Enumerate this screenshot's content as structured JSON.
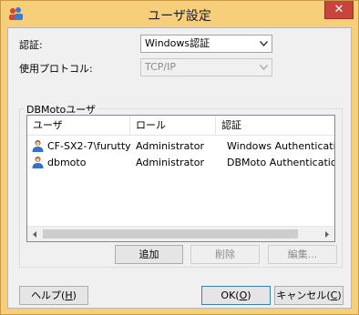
{
  "window": {
    "title": "ユーザ設定",
    "close_label": "✕"
  },
  "form": {
    "auth_label": "認証:",
    "auth_value": "Windows認証",
    "protocol_label": "使用プロトコル:",
    "protocol_value": "TCP/IP"
  },
  "group": {
    "label": "DBMotoユーザ",
    "columns": [
      "ユーザ",
      "ロール",
      "認証"
    ],
    "rows": [
      {
        "user": "CF-SX2-7\\furutty",
        "role": "Administrator",
        "auth": "Windows Authentication"
      },
      {
        "user": "dbmoto",
        "role": "Administrator",
        "auth": "DBMoto Authentication"
      }
    ],
    "buttons": {
      "add": "追加",
      "delete": "削除",
      "edit": "編集..."
    }
  },
  "footer": {
    "help_prefix": "ヘルプ(",
    "help_key": "H",
    "help_suffix": ")",
    "ok_prefix": "OK(",
    "ok_key": "O",
    "ok_suffix": ")",
    "cancel_prefix": "キャンセル(",
    "cancel_key": "C",
    "cancel_suffix": ")"
  },
  "icons": {
    "app": "users-app-icon",
    "user": "user-icon"
  }
}
